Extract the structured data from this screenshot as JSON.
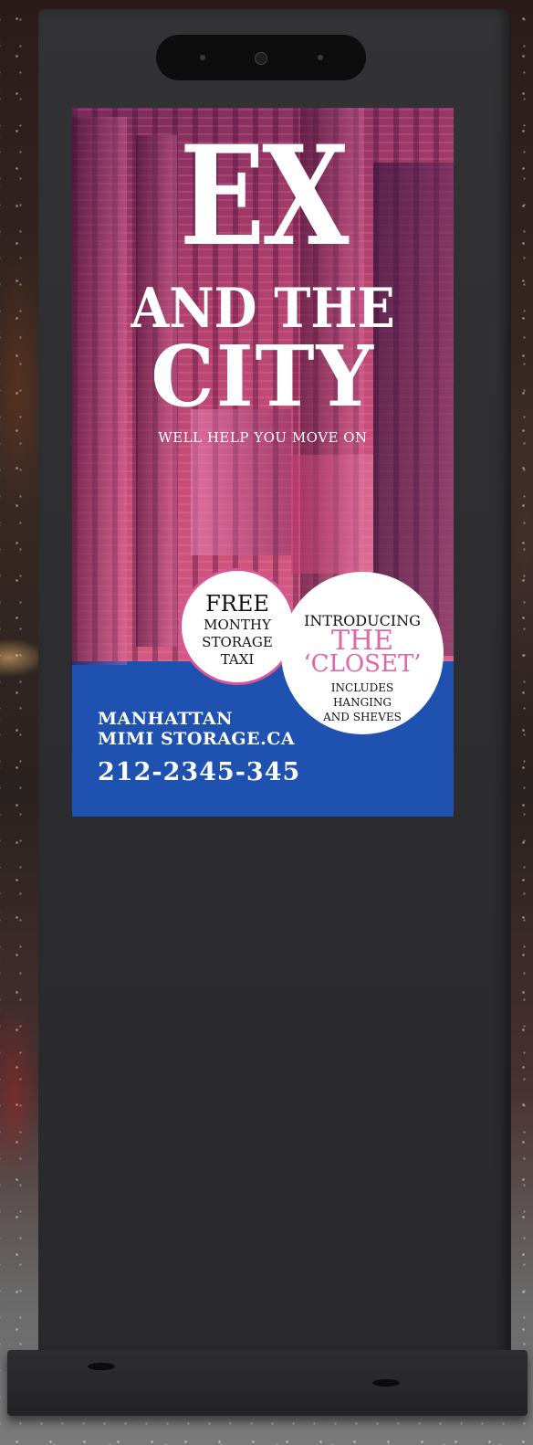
{
  "poster": {
    "title_ex": "EX",
    "title_and_the": "AND THE",
    "title_city": "CITY",
    "tagline": "WELL HELP YOU MOVE ON",
    "free_badge": {
      "heading": "FREE",
      "line1": "MONTHY",
      "line2": "STORAGE",
      "line3": "TAXI"
    },
    "closet_badge": {
      "intro": "INTRODUCING",
      "the": "THE",
      "closet": "‘CLOSET’",
      "line1": "INCLUDES",
      "line2": "HANGING",
      "line3": "AND SHEVES"
    },
    "company_line1": "MANHATTAN",
    "company_line2": "MIMI STORAGE.CA",
    "phone": "212-2345-345"
  },
  "colors": {
    "footer_blue": "#1f52b0",
    "accent_pink": "#e066a8",
    "kiosk_body": "#2e2e30"
  },
  "icons": [
    "camera-icon"
  ]
}
